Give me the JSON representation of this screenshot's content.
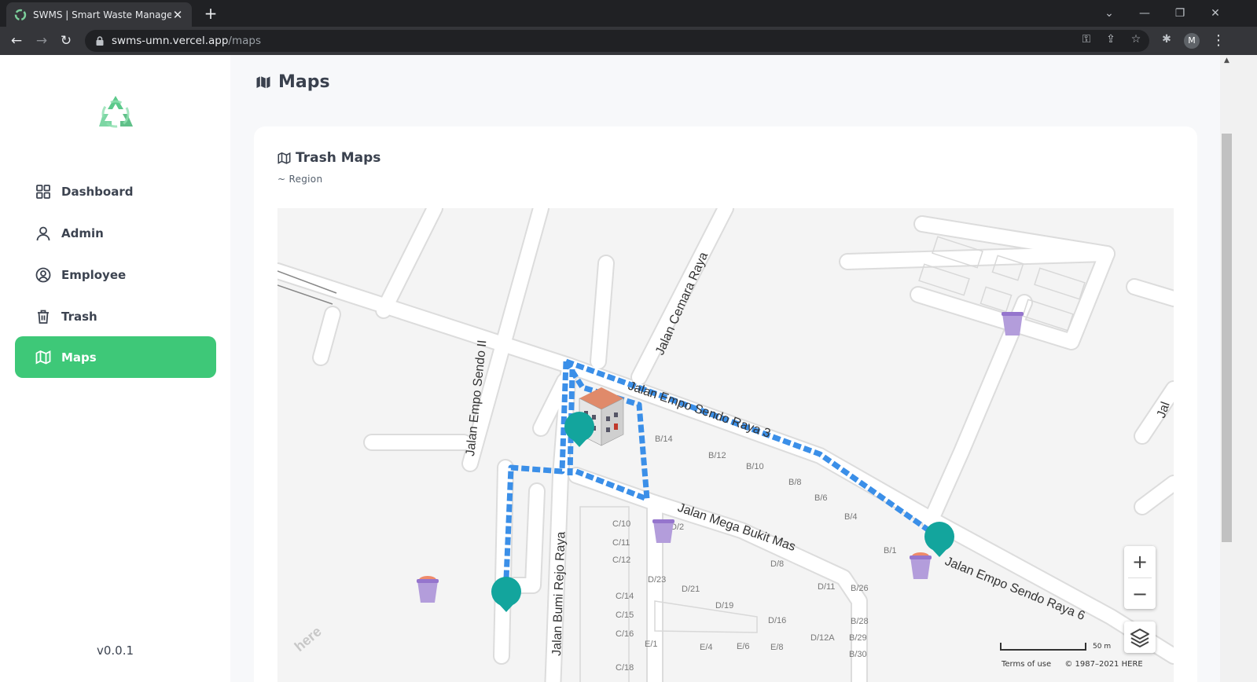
{
  "browser": {
    "tab_title": "SWMS | Smart Waste Manageme",
    "tab_close": "✕",
    "new_tab": "+",
    "url_host": "swms-umn.vercel.app",
    "url_path": "/maps",
    "profile_initial": "M"
  },
  "sidebar": {
    "items": [
      {
        "label": "Dashboard",
        "icon": "dashboard-grid-icon",
        "active": false
      },
      {
        "label": "Admin",
        "icon": "user-icon",
        "active": false
      },
      {
        "label": "Employee",
        "icon": "user-circle-icon",
        "active": false
      },
      {
        "label": "Trash",
        "icon": "trash-icon",
        "active": false
      },
      {
        "label": "Maps",
        "icon": "map-icon",
        "active": true
      }
    ],
    "version": "v0.0.1"
  },
  "page": {
    "title": "Maps"
  },
  "card": {
    "title": "Trash Maps",
    "subtitle": "~ Region"
  },
  "map": {
    "street_labels": {
      "cemara": "Jalan Cemara Raya",
      "sendo2": "Jalan Empo Sendo II",
      "sendoraya3": "Jalan Empo Sendo Raya 3",
      "mega": "Jalan Mega Bukit Mas",
      "bumi": "Jalan Bumi Rejo Raya",
      "sendoraya6": "Jalan Empo Sendo Raya 6",
      "jal": "Jal"
    },
    "house_labels": [
      "B/14",
      "B/12",
      "B/10",
      "B/8",
      "B/6",
      "B/4",
      "B/1",
      "D/2",
      "C/10",
      "C/11",
      "C/12",
      "D/23",
      "D/21",
      "D/19",
      "D/8",
      "D/11",
      "B/26",
      "C/14",
      "C/15",
      "C/16",
      "D/16",
      "B/28",
      "B/29",
      "D/12A",
      "B/30",
      "E/1",
      "E/4",
      "E/6",
      "E/8",
      "C/18"
    ],
    "zoom_in": "+",
    "zoom_out": "−",
    "scale": "50 m",
    "terms": "Terms of use",
    "copyright": "© 1987–2021 HERE",
    "brand": "here",
    "colors": {
      "route": "#3b8fe8",
      "marker": "#13a59d",
      "bin": "#b39ddb",
      "active_nav": "#3ec878"
    }
  }
}
